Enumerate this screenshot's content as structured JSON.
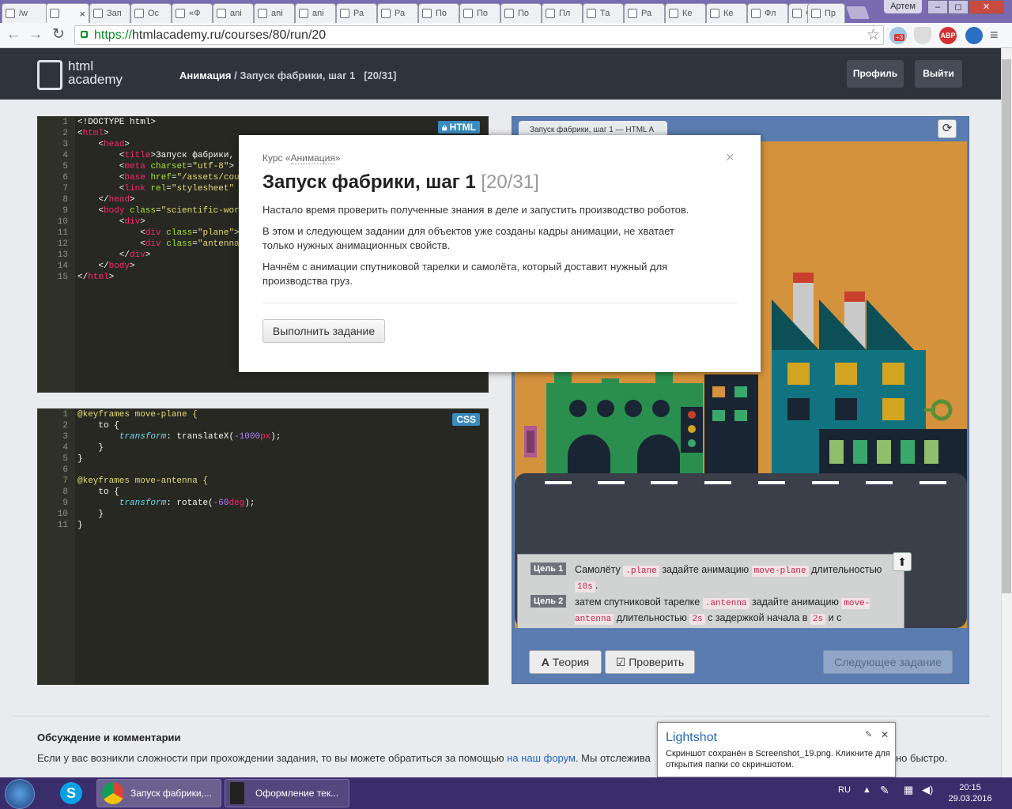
{
  "browser": {
    "tabs": [
      "/w",
      "",
      "Зап",
      "Ос",
      "«Ф",
      "ani",
      "ani",
      "ani",
      "Ра",
      "Ра",
      "По",
      "По",
      "По",
      "Пл",
      "Та",
      "Ра",
      "Ке",
      "Ке",
      "Фл",
      "Фл",
      "Пр"
    ],
    "user": "Артем",
    "window_controls": [
      "–",
      "◻",
      "✕"
    ],
    "url_proto": "https://",
    "url_rest": "htmlacademy.ru/courses/80/run/20",
    "ext_badge": "+3",
    "ext_abp": "ABP"
  },
  "header": {
    "logo_line1": "html",
    "logo_line2": "academy",
    "crumb_course": "Анимация",
    "crumb_rest": " / Запуск фабрики, шаг 1   [20/31]",
    "profile_label": "Профиль",
    "logout_label": "Выйти"
  },
  "html_editor": {
    "badge": "HTML",
    "line_numbers": [
      "1",
      "2",
      "3",
      "4",
      "5",
      "6",
      "7",
      "8",
      "9",
      "10",
      "11",
      "12",
      "13",
      "14",
      "15"
    ]
  },
  "css_editor": {
    "badge": "CSS",
    "line_numbers": [
      "1",
      "2",
      "3",
      "4",
      "5",
      "6",
      "7",
      "8",
      "9",
      "10",
      "11"
    ]
  },
  "preview": {
    "tab_label": "Запуск фабрики, шаг 1 — HTML A",
    "refresh_icon": "⟳",
    "up_icon": "⬆",
    "goals": [
      {
        "tag": "Цель 1",
        "t1": "Самолёту ",
        "c1": ".plane",
        "t2": " задайте анимацию ",
        "c2": "move-plane",
        "t3": " длительностью ",
        "c3": "10s",
        "t4": "."
      },
      {
        "tag": "Цель 2",
        "t1": "затем спутниковой тарелке ",
        "c1": ".antenna",
        "t2": " задайте анимацию ",
        "c2": "move-antenna",
        "t3": " длительностью ",
        "c3": "2s",
        "t4": " с задержкой начала в ",
        "c4": "2s",
        "t5": " и с сохранением своего состояния после анимации."
      }
    ],
    "theory_label": "Теория",
    "check_label": "Проверить",
    "next_label": "Следующее задание"
  },
  "modal": {
    "course_prefix": "Курс «",
    "course_link": "Анимация",
    "course_suffix": "»",
    "title": "Запуск фабрики, шаг 1",
    "counter": "[20/31]",
    "close": "×",
    "p1": "Настало время проверить полученные знания в деле и запустить производство роботов.",
    "p2": "В этом и следующем задании для объектов уже созданы кадры анимации, не хватает только нужных анимационных свойств.",
    "p3": "Начнём с анимации спутниковой тарелки и самолёта, который доставит нужный для производства груз.",
    "button": "Выполнить задание"
  },
  "discussion": {
    "title": "Обсуждение и комментарии",
    "text_before": "Если у вас возникли сложности при прохождении задания, то вы можете обратиться за помощью ",
    "link": "на наш форум",
    "text_after": ". Мы отслежива",
    "text_tail": "но быстро."
  },
  "lightshot": {
    "title": "Lightshot",
    "text": "Скриншот сохранён в Screenshot_19.png. Кликните для открытия папки со скриншотом.",
    "close": "✕",
    "pin": "✎"
  },
  "taskbar": {
    "items": [
      "Запуск фабрики,...",
      "Оформление тек..."
    ],
    "lang": "RU",
    "time": "20:15",
    "date": "29.03.2016"
  },
  "colors": {
    "accent": "#2e333c",
    "link": "#1e66c7",
    "scene_bg": "#d3923b",
    "preview_frame": "#5b7cb0"
  }
}
